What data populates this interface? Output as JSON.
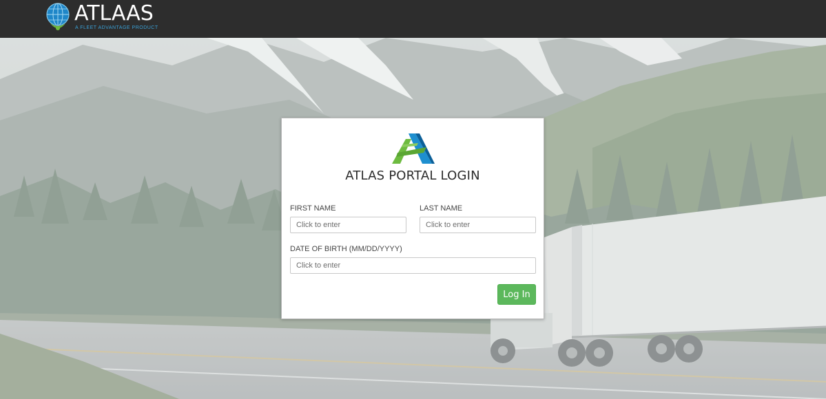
{
  "header": {
    "brand_name": "ATLAAS",
    "brand_tagline": "A FLEET ADVANTAGE PRODUCT"
  },
  "login": {
    "title": "ATLAS PORTAL LOGIN",
    "first_name_label": "FIRST NAME",
    "first_name_placeholder": "Click to enter",
    "first_name_value": "",
    "last_name_label": "LAST NAME",
    "last_name_placeholder": "Click to enter",
    "last_name_value": "",
    "dob_label": "DATE OF BIRTH (MM/DD/YYYY)",
    "dob_placeholder": "Click to enter",
    "dob_value": "",
    "login_button_label": "Log In"
  },
  "icons": {
    "brand_logo": "globe-pin-logo-icon",
    "card_logo": "atlas-a-logo-icon"
  },
  "colors": {
    "topbar": "#2d2d2d",
    "brand_tagline": "#3aa0d6",
    "login_button": "#5cb85c",
    "logo_green": "#6dbb3f",
    "logo_blue": "#1e8fcf"
  }
}
